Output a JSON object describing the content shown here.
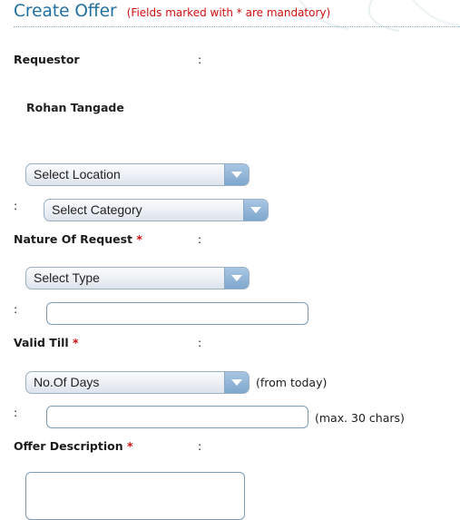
{
  "header": {
    "title": "Create Offer",
    "mandatory_note": "(Fields marked with * are mandatory)"
  },
  "colon": ":",
  "requestor": {
    "label": "Requestor",
    "value": "Rohan Tangade"
  },
  "location_select": {
    "selected": "Select Location"
  },
  "category_select": {
    "selected": "Select Category"
  },
  "nature_of_request": {
    "label": "Nature Of Request",
    "required_mark": "*"
  },
  "type_select": {
    "selected": "Select Type"
  },
  "type_input": {
    "value": ""
  },
  "valid_till": {
    "label": "Valid Till",
    "required_mark": "*"
  },
  "days_select": {
    "selected": "No.Of Days",
    "hint": "(from today)"
  },
  "valid_input": {
    "value": "",
    "hint": "(max. 30 chars)"
  },
  "offer_description": {
    "label": "Offer Description",
    "required_mark": "*",
    "value": ""
  },
  "colors": {
    "title": "#1f6f9f",
    "required": "#d01010",
    "dropdown_arrow": "#7ea6cd"
  }
}
